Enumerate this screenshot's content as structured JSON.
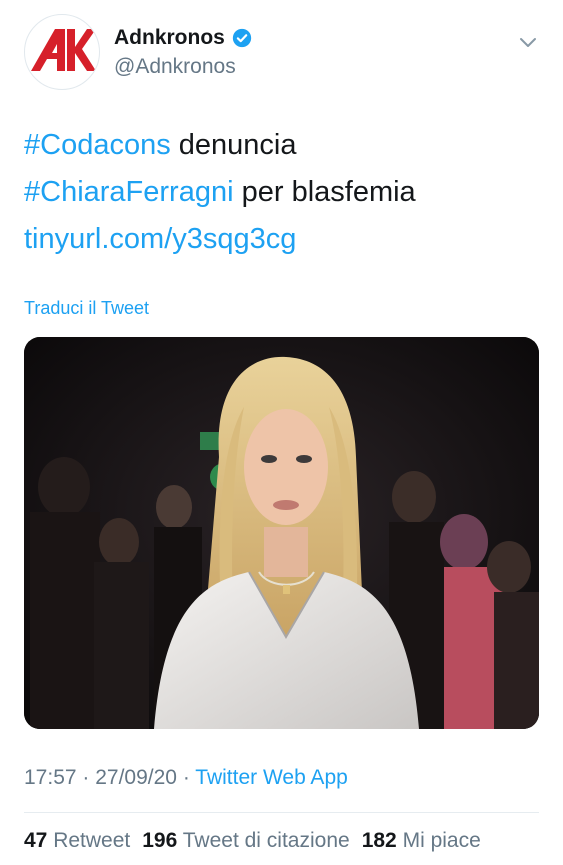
{
  "author": {
    "display_name": "Adnkronos",
    "handle": "@Adnkronos",
    "logo_text": "AK",
    "verified_icon": "verified-badge-icon"
  },
  "tweet": {
    "line1": {
      "hashtag": "#Codacons",
      "text": " denuncia"
    },
    "line2": {
      "hashtag": "#ChiaraFerragni",
      "text": " per blasfemia"
    },
    "link": "tinyurl.com/y3sqg3cg",
    "translate_label": "Traduci il Tweet"
  },
  "meta": {
    "time": "17:57",
    "sep1": " · ",
    "date": "27/09/20",
    "sep2": " · ",
    "source": "Twitter Web App"
  },
  "stats": {
    "retweets": "47",
    "retweets_label": "Retweet",
    "quotes": "196",
    "quotes_label": "Tweet di citazione",
    "likes": "182",
    "likes_label": "Mi piace"
  },
  "colors": {
    "accent": "#1da1f2",
    "text": "#14171a",
    "secondary": "#657786",
    "logo_red": "#d6202a"
  }
}
